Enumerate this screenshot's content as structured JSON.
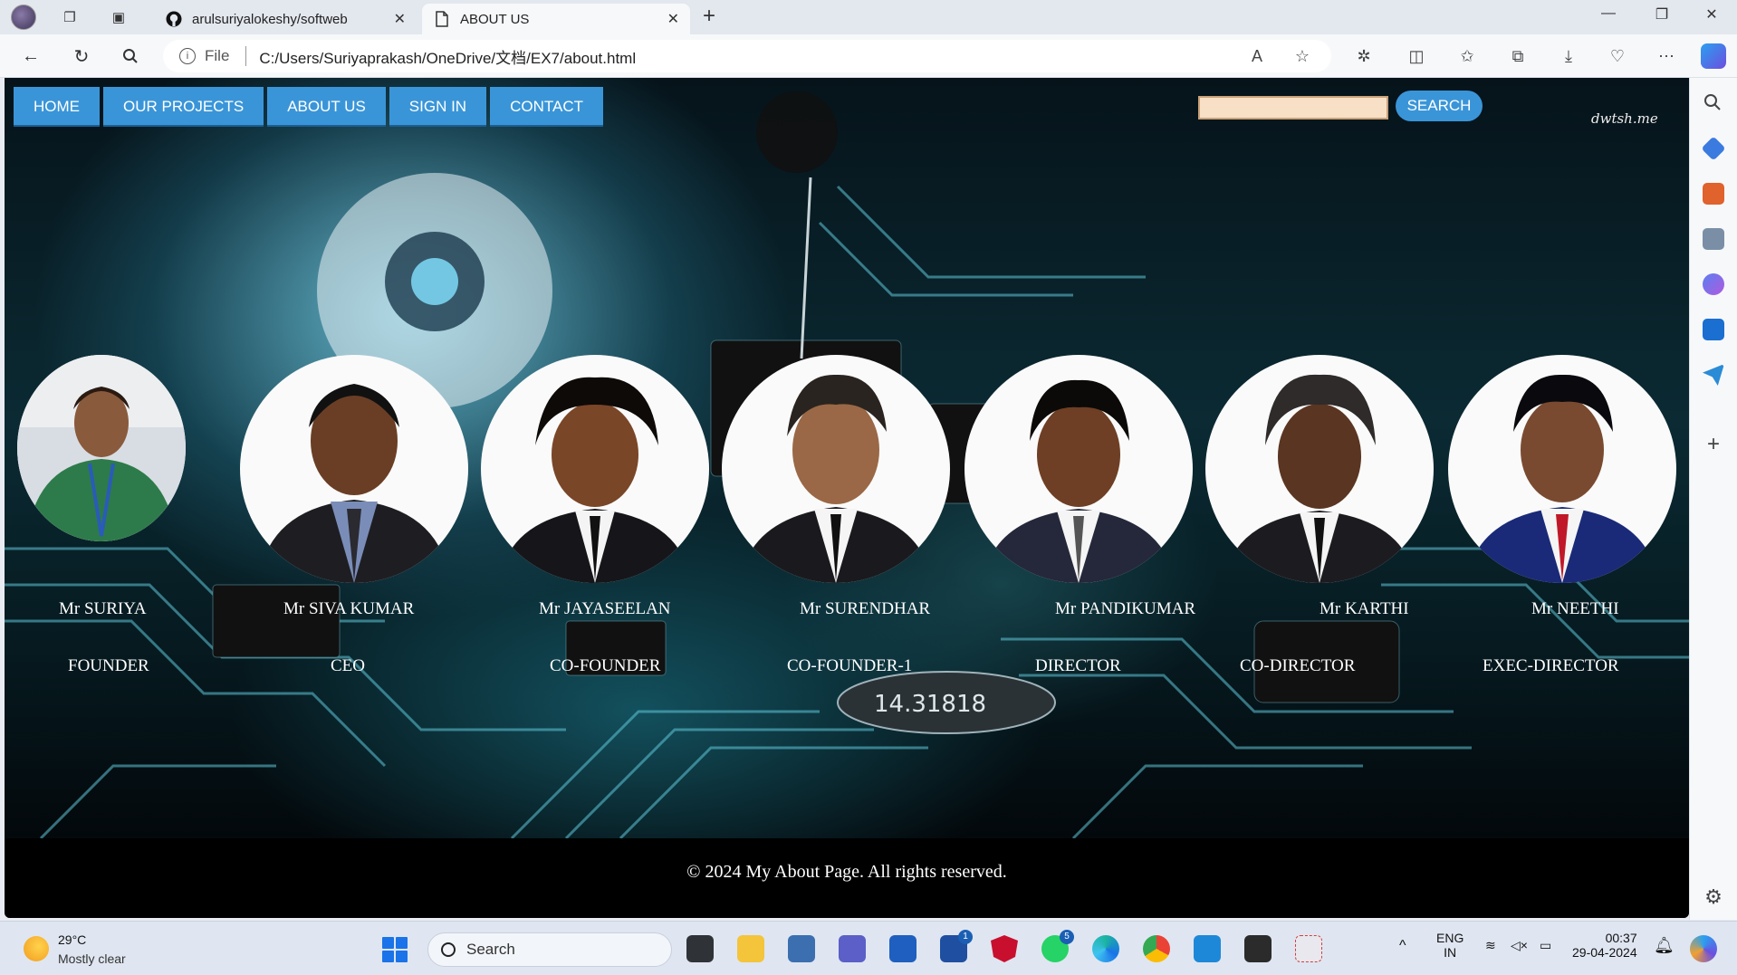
{
  "browser": {
    "tabs": [
      {
        "title": "arulsuriyalokeshy/softweb",
        "icon": "github-icon",
        "active": false
      },
      {
        "title": "ABOUT US",
        "icon": "page-icon",
        "active": true
      }
    ],
    "address": {
      "scheme_label": "File",
      "url": "C:/Users/Suriyaprakash/OneDrive/文档/EX7/about.html"
    }
  },
  "site": {
    "nav": [
      {
        "label": "HOME"
      },
      {
        "label": "OUR PROJECTS"
      },
      {
        "label": "ABOUT US"
      },
      {
        "label": "SIGN IN"
      },
      {
        "label": "CONTACT"
      }
    ],
    "search": {
      "value": "",
      "button_label": "SEARCH"
    },
    "watermark": "dwtsh.me",
    "team": [
      {
        "name": "Mr SURIYA",
        "role": "FOUNDER"
      },
      {
        "name": "Mr SIVA KUMAR",
        "role": "CEO"
      },
      {
        "name": "Mr JAYASEELAN",
        "role": "CO-FOUNDER"
      },
      {
        "name": "Mr SURENDHAR",
        "role": "CO-FOUNDER-1"
      },
      {
        "name": "Mr PANDIKUMAR",
        "role": "DIRECTOR"
      },
      {
        "name": "Mr KARTHI",
        "role": "CO-DIRECTOR"
      },
      {
        "name": "Mr NEETHI",
        "role": "EXEC-DIRECTOR"
      }
    ],
    "footer": "© 2024 My About Page. All rights reserved.",
    "colors": {
      "nav_bg": "#3a95d8",
      "search_field": "#f7e0c6"
    }
  },
  "taskbar": {
    "weather": {
      "temp": "29°C",
      "desc": "Mostly clear"
    },
    "search_label": "Search",
    "lang": {
      "line1": "ENG",
      "line2": "IN"
    },
    "clock": {
      "time": "00:37",
      "date": "29-04-2024"
    },
    "badges": {
      "linkedin": "1",
      "whatsapp": "5"
    }
  }
}
